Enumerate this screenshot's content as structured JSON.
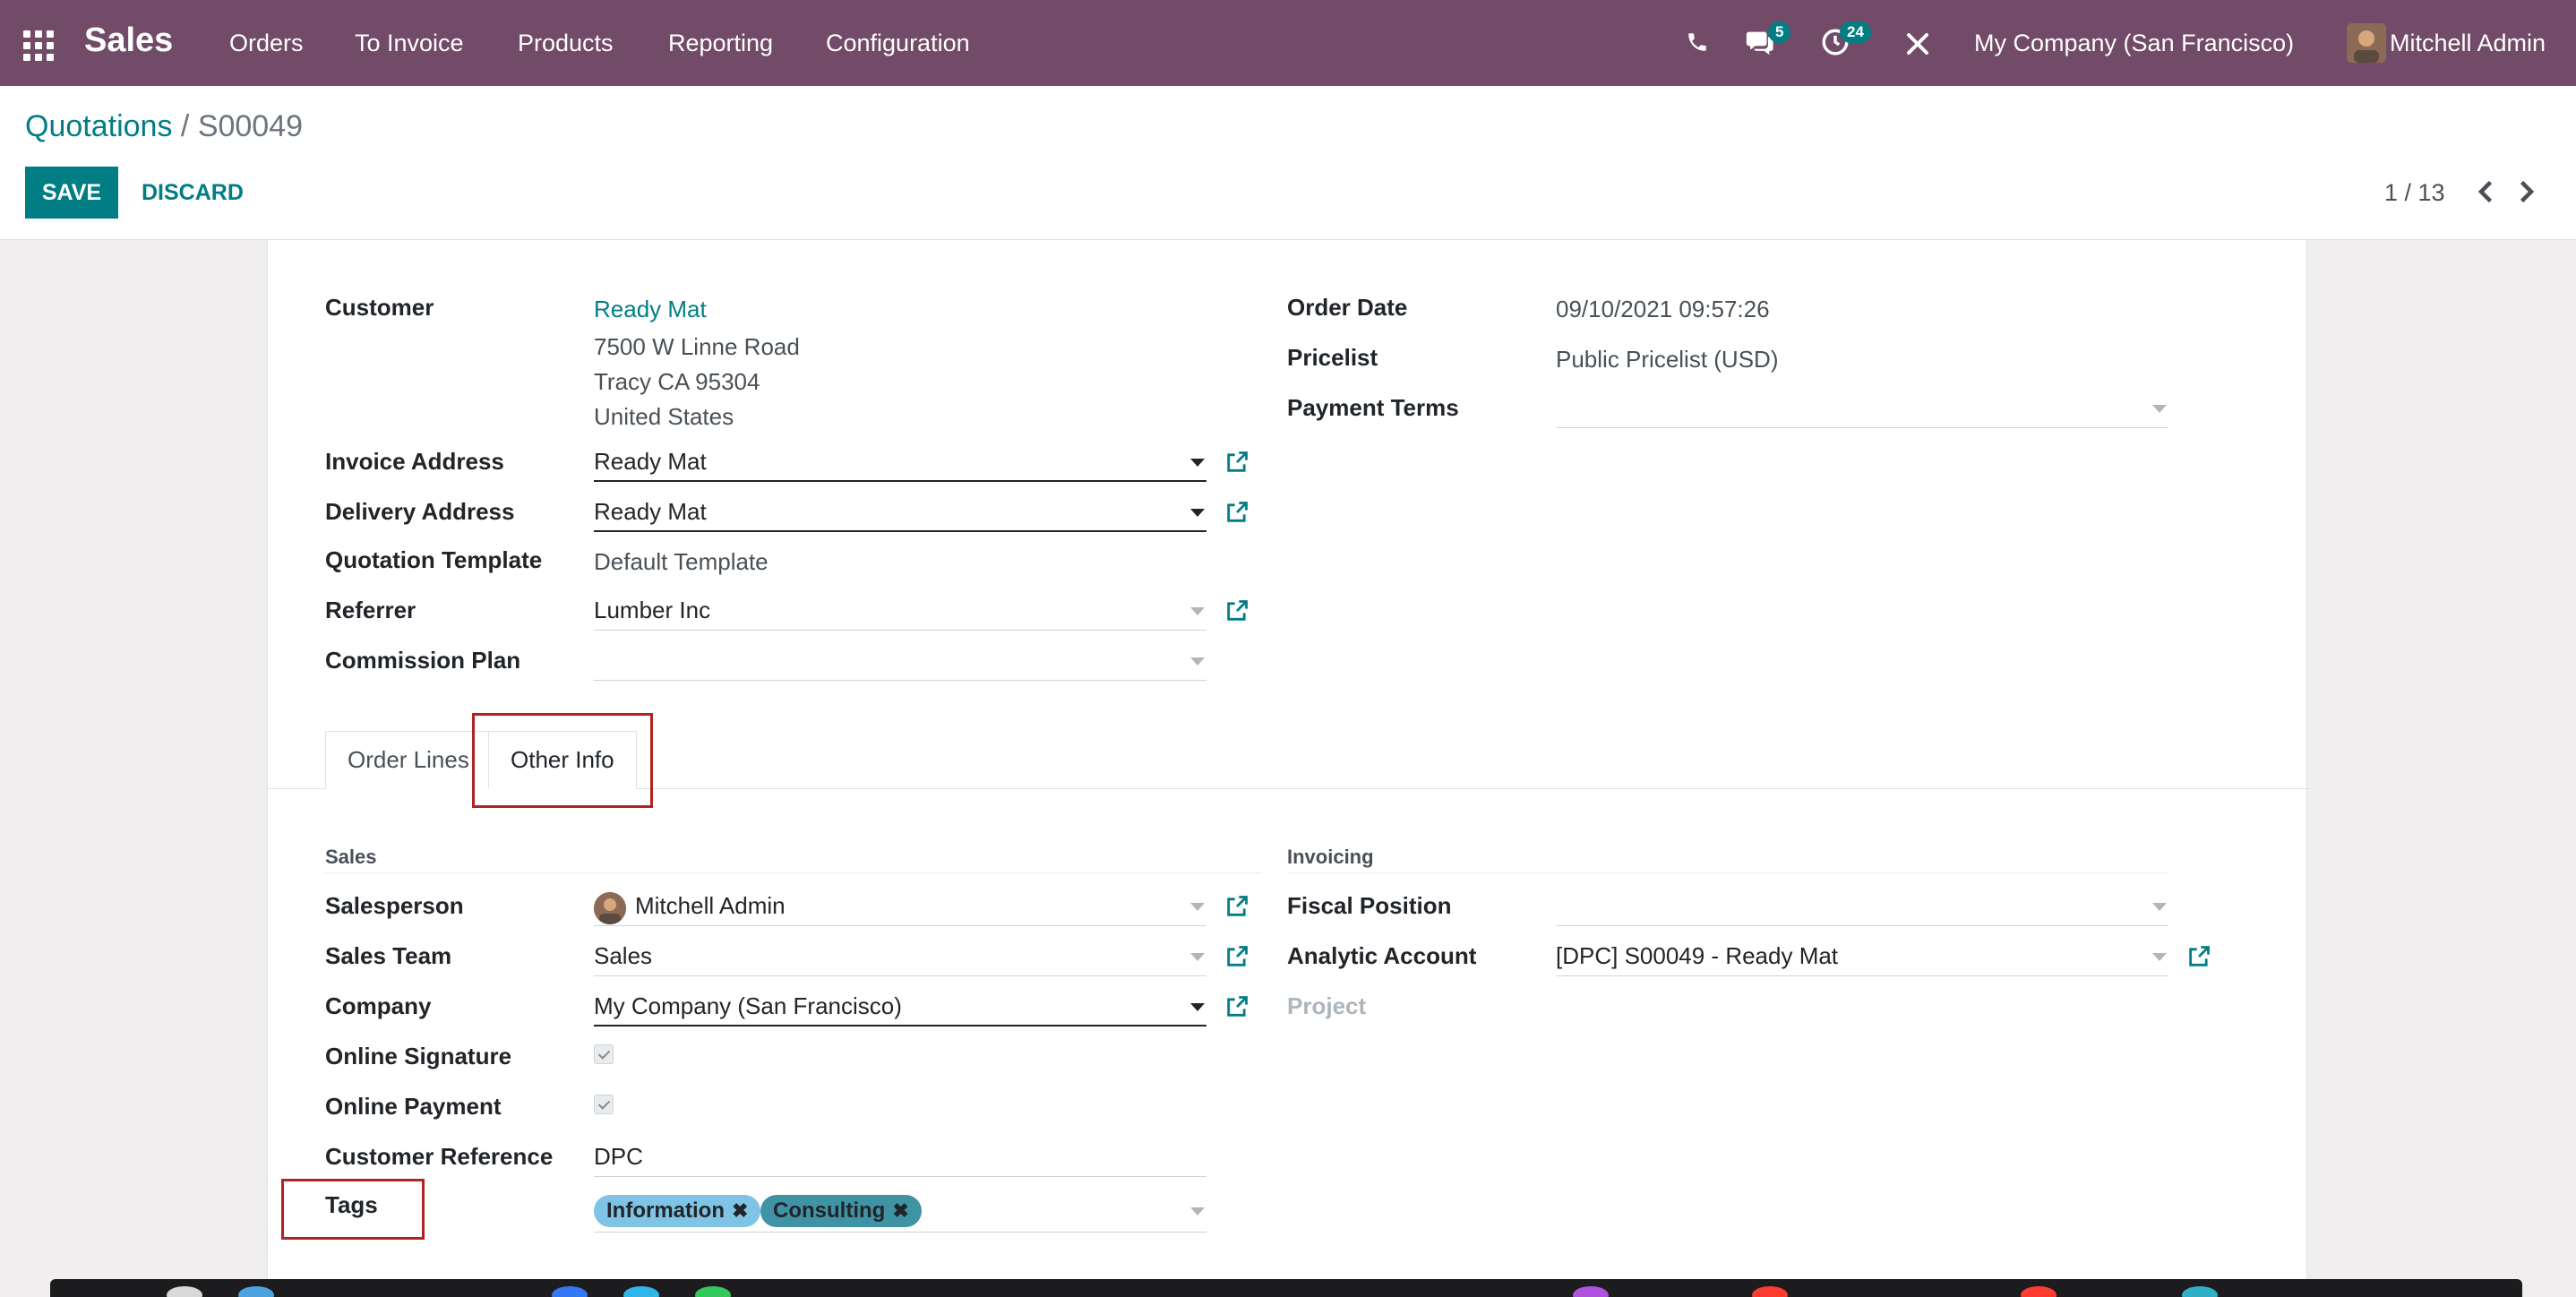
{
  "navbar": {
    "app_name": "Sales",
    "menu": [
      "Orders",
      "To Invoice",
      "Products",
      "Reporting",
      "Configuration"
    ],
    "messages_badge": "5",
    "activities_badge": "24",
    "company": "My Company (San Francisco)",
    "user": "Mitchell Admin",
    "bg_color": "#714B67"
  },
  "control": {
    "breadcrumb_parent": "Quotations",
    "breadcrumb_sep": "/",
    "breadcrumb_current": "S00049",
    "save_label": "SAVE",
    "discard_label": "DISCARD",
    "pager": "1 / 13"
  },
  "form": {
    "customer_label": "Customer",
    "customer_name": "Ready Mat",
    "customer_address": [
      "7500 W Linne Road",
      "Tracy CA 95304",
      "United States"
    ],
    "invoice_address_label": "Invoice Address",
    "invoice_address": "Ready Mat",
    "delivery_address_label": "Delivery Address",
    "delivery_address": "Ready Mat",
    "quotation_template_label": "Quotation Template",
    "quotation_template": "Default Template",
    "referrer_label": "Referrer",
    "referrer": "Lumber Inc",
    "commission_plan_label": "Commission Plan",
    "commission_plan": "",
    "order_date_label": "Order Date",
    "order_date": "09/10/2021 09:57:26",
    "pricelist_label": "Pricelist",
    "pricelist": "Public Pricelist (USD)",
    "payment_terms_label": "Payment Terms",
    "payment_terms": ""
  },
  "tabs": [
    {
      "label": "Order Lines",
      "active": false
    },
    {
      "label": "Other Info",
      "active": true
    }
  ],
  "other_info": {
    "sales_section": "Sales",
    "salesperson_label": "Salesperson",
    "salesperson": "Mitchell Admin",
    "sales_team_label": "Sales Team",
    "sales_team": "Sales",
    "company_label": "Company",
    "company": "My Company (San Francisco)",
    "online_signature_label": "Online Signature",
    "online_signature": true,
    "online_payment_label": "Online Payment",
    "online_payment": true,
    "customer_reference_label": "Customer Reference",
    "customer_reference": "DPC",
    "tags_label": "Tags",
    "tags": [
      {
        "label": "Information",
        "color": "#7fc3e5"
      },
      {
        "label": "Consulting",
        "color": "#3f93a5"
      }
    ],
    "invoicing_section": "Invoicing",
    "fiscal_position_label": "Fiscal Position",
    "fiscal_position": "",
    "analytic_account_label": "Analytic Account",
    "analytic_account": "[DPC] S00049 - Ready Mat",
    "project_label": "Project"
  },
  "colors": {
    "accent": "#017e84",
    "highlight": "#b22222"
  }
}
